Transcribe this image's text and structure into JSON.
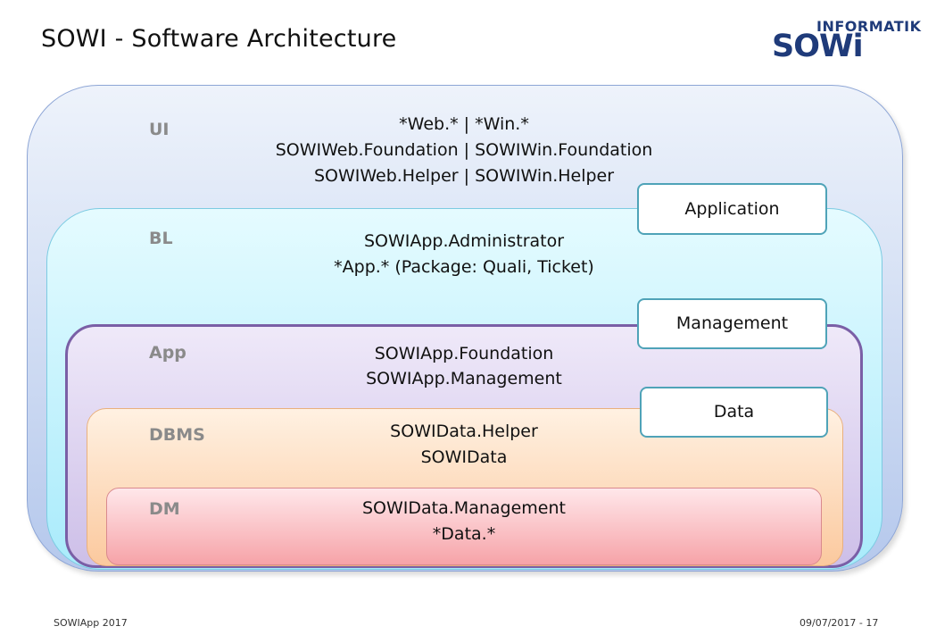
{
  "title": "SOWI - Software Architecture",
  "logo": {
    "top_text": "INFORMATIK",
    "main_text": "SOWi"
  },
  "layers": {
    "ui": {
      "label": "UI",
      "lines": [
        "*Web.* | *Win.*",
        "SOWIWeb.Foundation | SOWIWin.Foundation",
        "SOWIWeb.Helper | SOWIWin.Helper"
      ]
    },
    "bl": {
      "label": "BL",
      "lines": [
        "SOWIApp.Administrator",
        "*App.* (Package: Quali, Ticket)"
      ]
    },
    "app": {
      "label": "App",
      "lines": [
        "SOWIApp.Foundation",
        "SOWIApp.Management"
      ]
    },
    "dbms": {
      "label": "DBMS",
      "lines": [
        "SOWIData.Helper",
        "SOWIData"
      ]
    },
    "dm": {
      "label": "DM",
      "lines": [
        "SOWIData.Management",
        "*Data.*"
      ]
    }
  },
  "tags": {
    "application": "Application",
    "management": "Management",
    "data": "Data"
  },
  "footer": {
    "left": "SOWIApp 2017",
    "right": "09/07/2017 - 17"
  },
  "colors": {
    "logo": "#1f3b7a",
    "logo_accent": "#e3262d",
    "tag_border": "#4fa3b8",
    "app_border": "#7a5fa6"
  }
}
